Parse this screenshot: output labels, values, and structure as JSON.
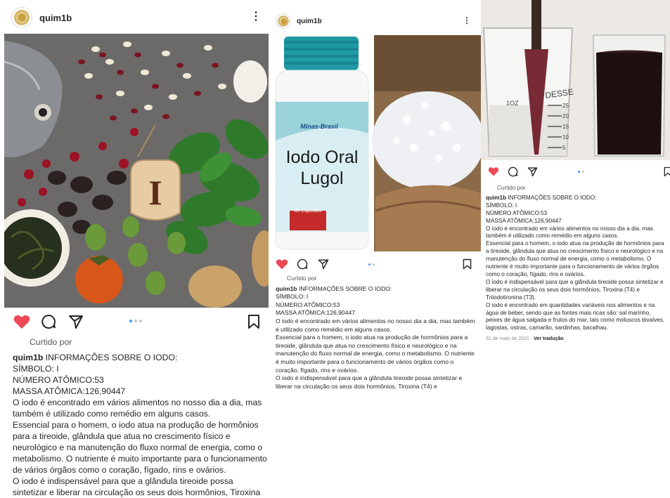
{
  "user": {
    "username": "quim1b"
  },
  "colors": {
    "like": "#ed4956",
    "dot_active": "#3897f0"
  },
  "post": {
    "liked_label": "Curtido por",
    "caption_title": "INFORMAÇÕES SOBRE O IODO:",
    "lines": {
      "symbol": "SÍMBOLO: I",
      "atomic_number": "NÚMERO ATÔMICO:53",
      "atomic_mass": "MASSA ATÔMICA:126,90447",
      "p1": "O iodo é encontrado em vários alimentos no nosso dia a dia, mas também é utilizado como remédio em alguns casos.",
      "p2": "Essencial para o homem, o iodo atua na produção de hormônios para a tireoide, glândula que atua no crescimento físico e neurológico e na manutenção do fluxo normal de energia, como o metabolismo. O nutriente é muito importante para o funcionamento de vários órgãos como o coração, fígado, rins e ovários.",
      "p3_cut": "O iodo é indispensável para que a glândula tireoide possa sintetizar e liberar na circulação os seus dois hormônios, Tiroxina (T4) e",
      "p3_full": "O iodo é indispensável para que a glândula tireoide possa sintetizar e liberar na circulação os seus dois hormônios, Tiroxina (T4) e Triiodotironina (T3).",
      "p4": "O iodo é encontrado em quantidades variáveis nos alimentos e na água de beber, sendo que as fontes mais ricas são: sal marinho, peixes de água salgada e frutos do mar, tais como moluscos bivalves, lagostas, ostras, camarão, sardinhas, bacalhau."
    },
    "date": "31 de maio de 2021",
    "separator": "·",
    "translate": "Ver tradução"
  },
  "images": {
    "letter_tag": "I",
    "bottle_brand": "Minas-Brasil",
    "bottle_label_line1": "Iodo Oral",
    "bottle_label_line2": "Lugol",
    "bottle_capsules": "60 Cápsulas",
    "cup_brand": "DESSE",
    "cup_oz": "1OZ",
    "cup_marks": [
      "25",
      "20",
      "15",
      "10",
      "5"
    ]
  },
  "icons": [
    "avatar",
    "more-options-icon",
    "heart-icon",
    "comment-icon",
    "share-icon",
    "bookmark-icon",
    "carousel-dots"
  ]
}
